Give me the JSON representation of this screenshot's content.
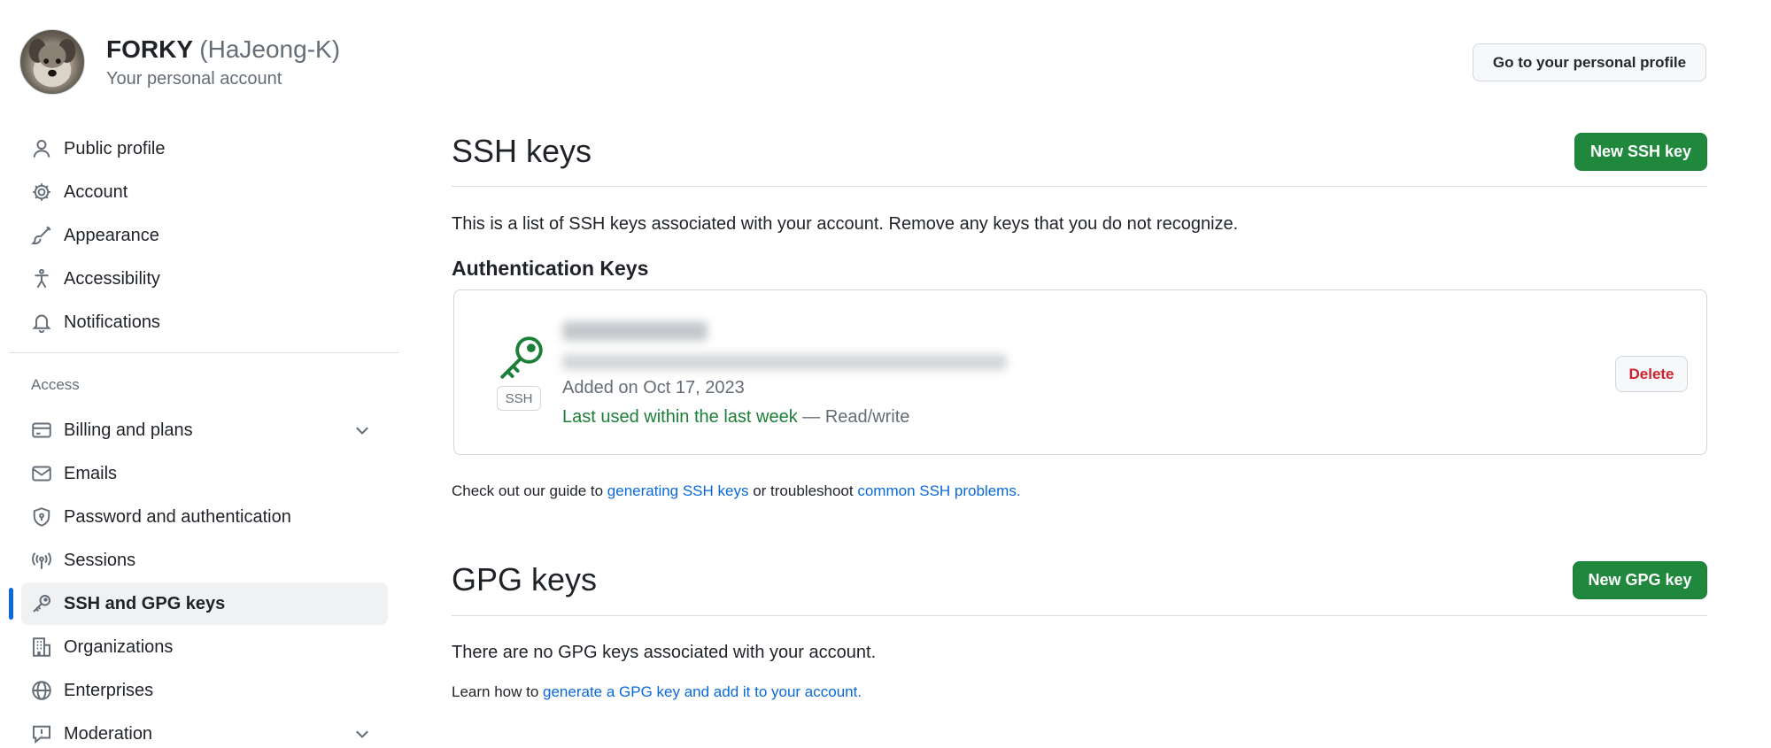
{
  "header": {
    "display_name": "FORKY",
    "login": "(HaJeong-K)",
    "subtitle": "Your personal account",
    "profile_button": "Go to your personal profile"
  },
  "sidebar": {
    "items": [
      {
        "label": "Public profile",
        "icon": "person-icon"
      },
      {
        "label": "Account",
        "icon": "gear-icon"
      },
      {
        "label": "Appearance",
        "icon": "paintbrush-icon"
      },
      {
        "label": "Accessibility",
        "icon": "accessibility-icon"
      },
      {
        "label": "Notifications",
        "icon": "bell-icon"
      }
    ],
    "access_heading": "Access",
    "access_items": [
      {
        "label": "Billing and plans",
        "icon": "credit-card-icon",
        "expandable": true
      },
      {
        "label": "Emails",
        "icon": "mail-icon"
      },
      {
        "label": "Password and authentication",
        "icon": "shield-lock-icon"
      },
      {
        "label": "Sessions",
        "icon": "broadcast-icon"
      },
      {
        "label": "SSH and GPG keys",
        "icon": "key-icon",
        "selected": true
      },
      {
        "label": "Organizations",
        "icon": "organization-icon"
      },
      {
        "label": "Enterprises",
        "icon": "globe-icon"
      },
      {
        "label": "Moderation",
        "icon": "report-icon",
        "expandable": true
      }
    ]
  },
  "ssh": {
    "title": "SSH keys",
    "new_button": "New SSH key",
    "description": "This is a list of SSH keys associated with your account. Remove any keys that you do not recognize.",
    "auth_heading": "Authentication Keys",
    "key": {
      "type_label": "SSH",
      "added": "Added on Oct 17, 2023",
      "last_used": "Last used within the last week",
      "access": "— Read/write",
      "delete_button": "Delete"
    },
    "guide_prefix": "Check out our guide to ",
    "guide_link": "generating SSH keys",
    "guide_mid": " or troubleshoot ",
    "guide_link2": "common SSH problems",
    "guide_suffix": "."
  },
  "gpg": {
    "title": "GPG keys",
    "new_button": "New GPG key",
    "empty": "There are no GPG keys associated with your account.",
    "learn_prefix": "Learn how to ",
    "learn_link": "generate a GPG key and add it to your account",
    "learn_suffix": "."
  },
  "colors": {
    "primary_green": "#1f883d",
    "link_blue": "#0969da",
    "danger_red": "#cf222e",
    "selected_bar": "#0969da"
  }
}
